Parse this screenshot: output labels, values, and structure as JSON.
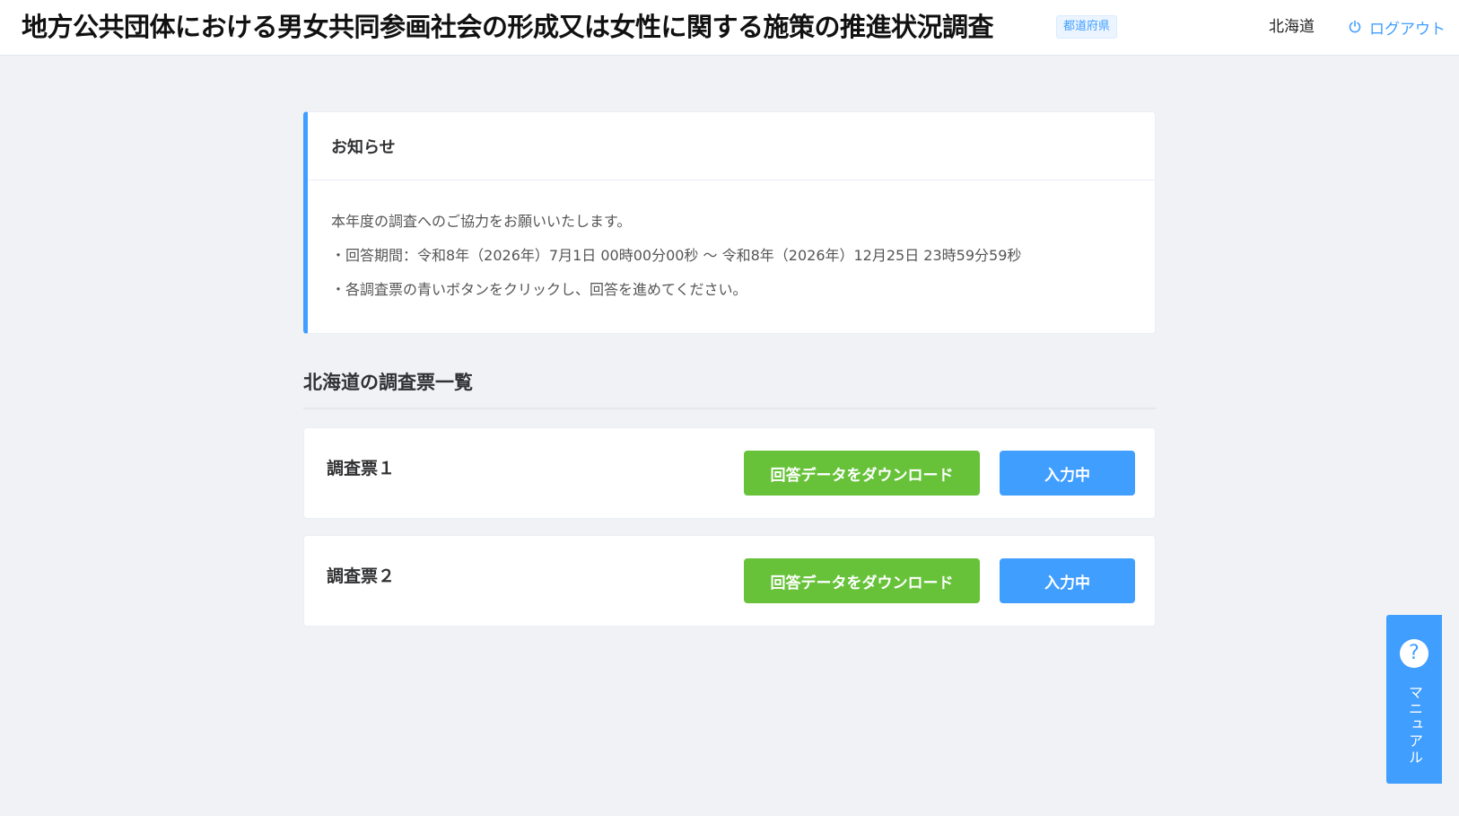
{
  "header": {
    "title": "地方公共団体における男女共同参画社会の形成又は女性に関する施策の推進状況調査",
    "role_badge": "都道府県",
    "user_name": "北海道",
    "logout_label": "ログアウト"
  },
  "notice": {
    "title": "お知らせ",
    "lines": [
      "本年度の調査へのご協力をお願いいたします。",
      "・回答期間：令和8年（2026年）7月1日 00時00分00秒 ～ 令和8年（2026年）12月25日 23時59分59秒",
      "・各調査票の青いボタンをクリックし、回答を進めてください。"
    ]
  },
  "survey_list": {
    "title": "北海道の調査票一覧",
    "items": [
      {
        "name": "調査票１",
        "download_label": "回答データをダウンロード",
        "status_label": "入力中"
      },
      {
        "name": "調査票２",
        "download_label": "回答データをダウンロード",
        "status_label": "入力中"
      }
    ]
  },
  "manual": {
    "icon_glyph": "?",
    "label": "マニュアル"
  },
  "colors": {
    "primary": "#409eff",
    "success": "#67c23a",
    "background": "#f0f2f5"
  },
  "icons": {
    "logout": "power-icon",
    "manual": "question-circle-icon"
  }
}
